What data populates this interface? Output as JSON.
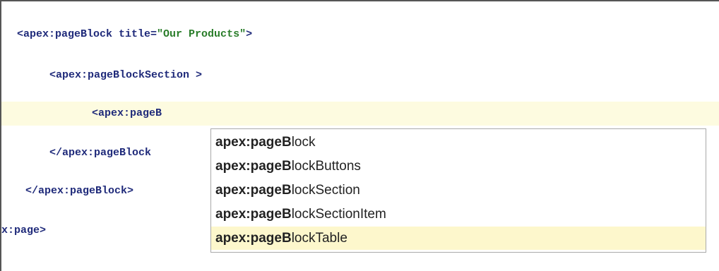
{
  "editor": {
    "lines": [
      {
        "text_pre": "<apex:pageBlock title=",
        "string": "\"Our Products\"",
        "text_post": ">"
      },
      {
        "text": "<apex:pageBlockSection >"
      },
      {
        "text": "<apex:pageB"
      },
      {
        "text": "</apex:pageBlock"
      },
      {
        "text": "</apex:pageBlock>"
      },
      {
        "text": "x:page>"
      }
    ]
  },
  "autocomplete": {
    "typed_prefix": "apex:pageB",
    "items": [
      {
        "match": "apex:pageB",
        "rest": "lock"
      },
      {
        "match": "apex:pageB",
        "rest": "lockButtons"
      },
      {
        "match": "apex:pageB",
        "rest": "lockSection"
      },
      {
        "match": "apex:pageB",
        "rest": "lockSectionItem"
      },
      {
        "match": "apex:pageB",
        "rest": "lockTable"
      }
    ],
    "selected_index": 4
  },
  "colors": {
    "tag": "#1f2a7a",
    "string": "#2a7d2a",
    "active_line": "#fdfbe0",
    "selected_item": "#fdf7cc"
  }
}
